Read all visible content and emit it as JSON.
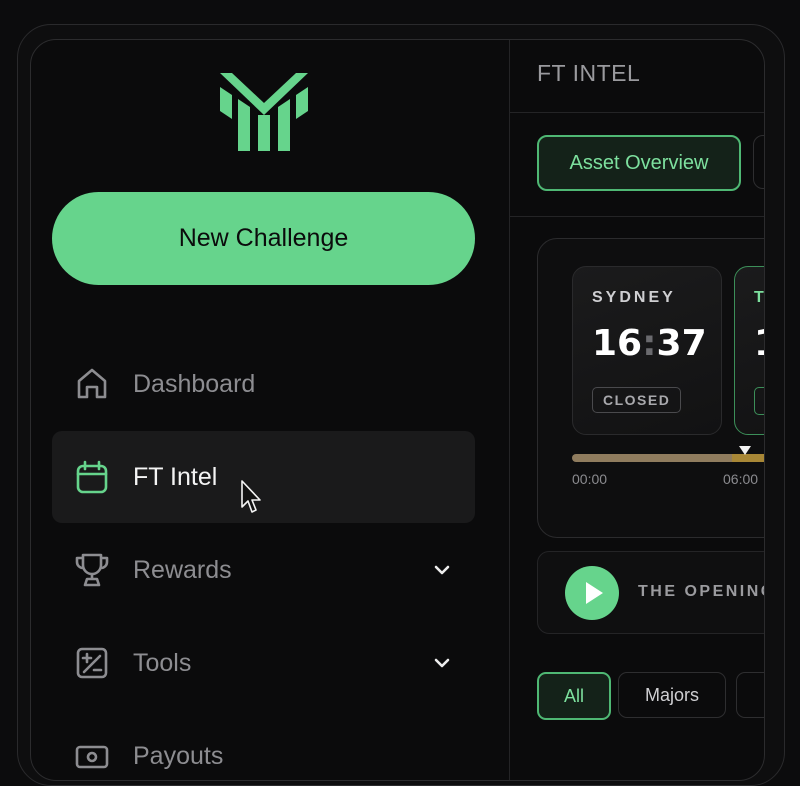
{
  "sidebar": {
    "new_button": "New Challenge",
    "items": [
      {
        "label": "Dashboard",
        "icon": "home-icon"
      },
      {
        "label": "FT Intel",
        "icon": "calendar-icon"
      },
      {
        "label": "Rewards",
        "icon": "trophy-icon"
      },
      {
        "label": "Tools",
        "icon": "calculator-icon"
      },
      {
        "label": "Payouts",
        "icon": "payout-icon"
      }
    ]
  },
  "main": {
    "title": "FT INTEL",
    "tabs": [
      {
        "label": "Asset Overview"
      },
      {
        "label": ""
      }
    ],
    "sessions": [
      {
        "city": "SYDNEY",
        "time_h": "16",
        "time_m": "37",
        "status": "CLOSED"
      },
      {
        "city": "T",
        "time": "1",
        "status": ""
      }
    ],
    "timeline": {
      "labels": [
        "00:00",
        "06:00"
      ]
    },
    "audio_label": "THE OPENING",
    "filters": [
      "All",
      "Majors",
      ""
    ]
  },
  "colors": {
    "accent": "#66d48c",
    "background": "#0b0b0c"
  }
}
